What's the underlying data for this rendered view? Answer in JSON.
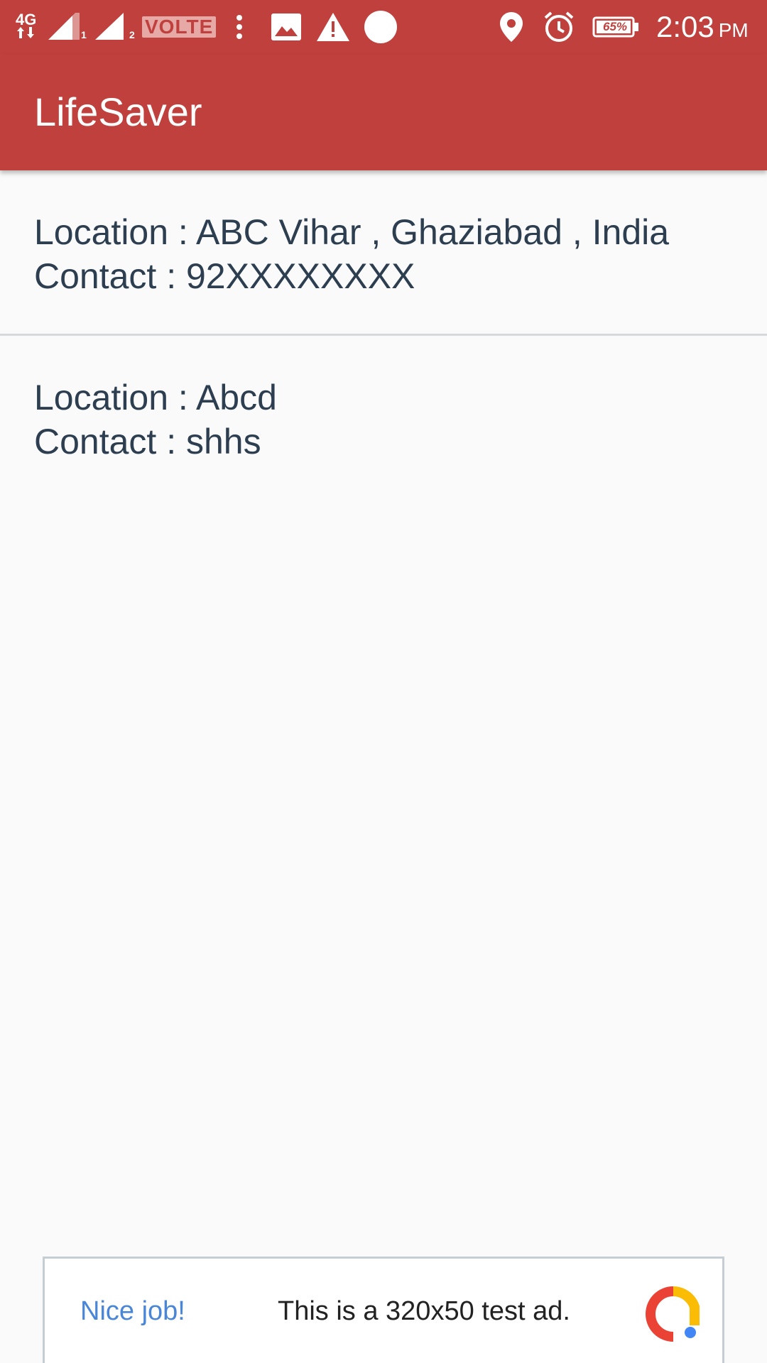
{
  "status_bar": {
    "network_label": "4G",
    "sim1_label": "1",
    "sim2_label": "2",
    "volte_label": "VOLTE",
    "battery_label": "65%",
    "battery_level": 0.65,
    "time": "2:03",
    "ampm": "PM",
    "icons": [
      "signal-sim1-icon",
      "signal-sim2-icon",
      "more-vertical-icon",
      "image-icon",
      "warning-icon",
      "circle-icon",
      "location-icon",
      "alarm-icon",
      "battery-icon"
    ]
  },
  "app_bar": {
    "title": "LifeSaver"
  },
  "list": {
    "items": [
      {
        "location": "Location : ABC Vihar , Ghaziabad , India",
        "contact": "Contact : 92XXXXXXXX"
      },
      {
        "location": "Location : Abcd",
        "contact": "Contact : shhs"
      }
    ]
  },
  "ad": {
    "nice_label": "Nice job!",
    "text": "This is a 320x50 test ad.",
    "logo_icon": "ad-logo-icon"
  },
  "colors": {
    "primary": "#bf403c",
    "list_text": "#2c3e50",
    "ad_link": "#4a86d8",
    "background": "#fafafa"
  }
}
